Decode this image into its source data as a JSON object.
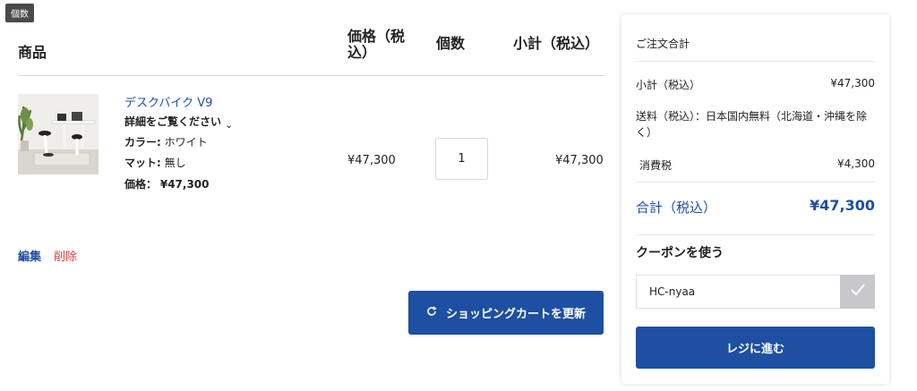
{
  "tooltip": "個数",
  "table": {
    "headers": {
      "product": "商品",
      "price": "価格（税込）",
      "qty": "個数",
      "subtotal": "小計（税込）"
    }
  },
  "item": {
    "name": "デスクバイク V9",
    "details_toggle": "詳細をご覧ください",
    "color_label": "カラー:",
    "color_value": "ホワイト",
    "mat_label": "マット:",
    "mat_value": "無し",
    "price_label": "価格：",
    "price_value": "¥47,300",
    "price": "¥47,300",
    "qty": "1",
    "subtotal": "¥47,300"
  },
  "actions": {
    "edit": "編集",
    "delete": "削除",
    "update_cart": "ショッピングカートを更新"
  },
  "summary": {
    "title": "ご注文合計",
    "subtotal_label": "小計（税込）",
    "subtotal_value": "¥47,300",
    "shipping_label": "送料（税込）：日本国内無料（北海道・沖縄を除く）",
    "tax_label": "消費税",
    "tax_value": "¥4,300",
    "total_label": "合計（税込）",
    "total_value": "¥47,300",
    "coupon_title": "クーポンを使う",
    "coupon_code": "HC-nyaa",
    "checkout": "レジに進む"
  },
  "colors": {
    "brand_blue": "#1d4fa3",
    "delete_red": "#e0403a",
    "apply_gray": "#c8c8cc"
  },
  "icons": {
    "refresh": "refresh-icon",
    "check": "check-icon",
    "chevron": "chevron-down-icon"
  }
}
